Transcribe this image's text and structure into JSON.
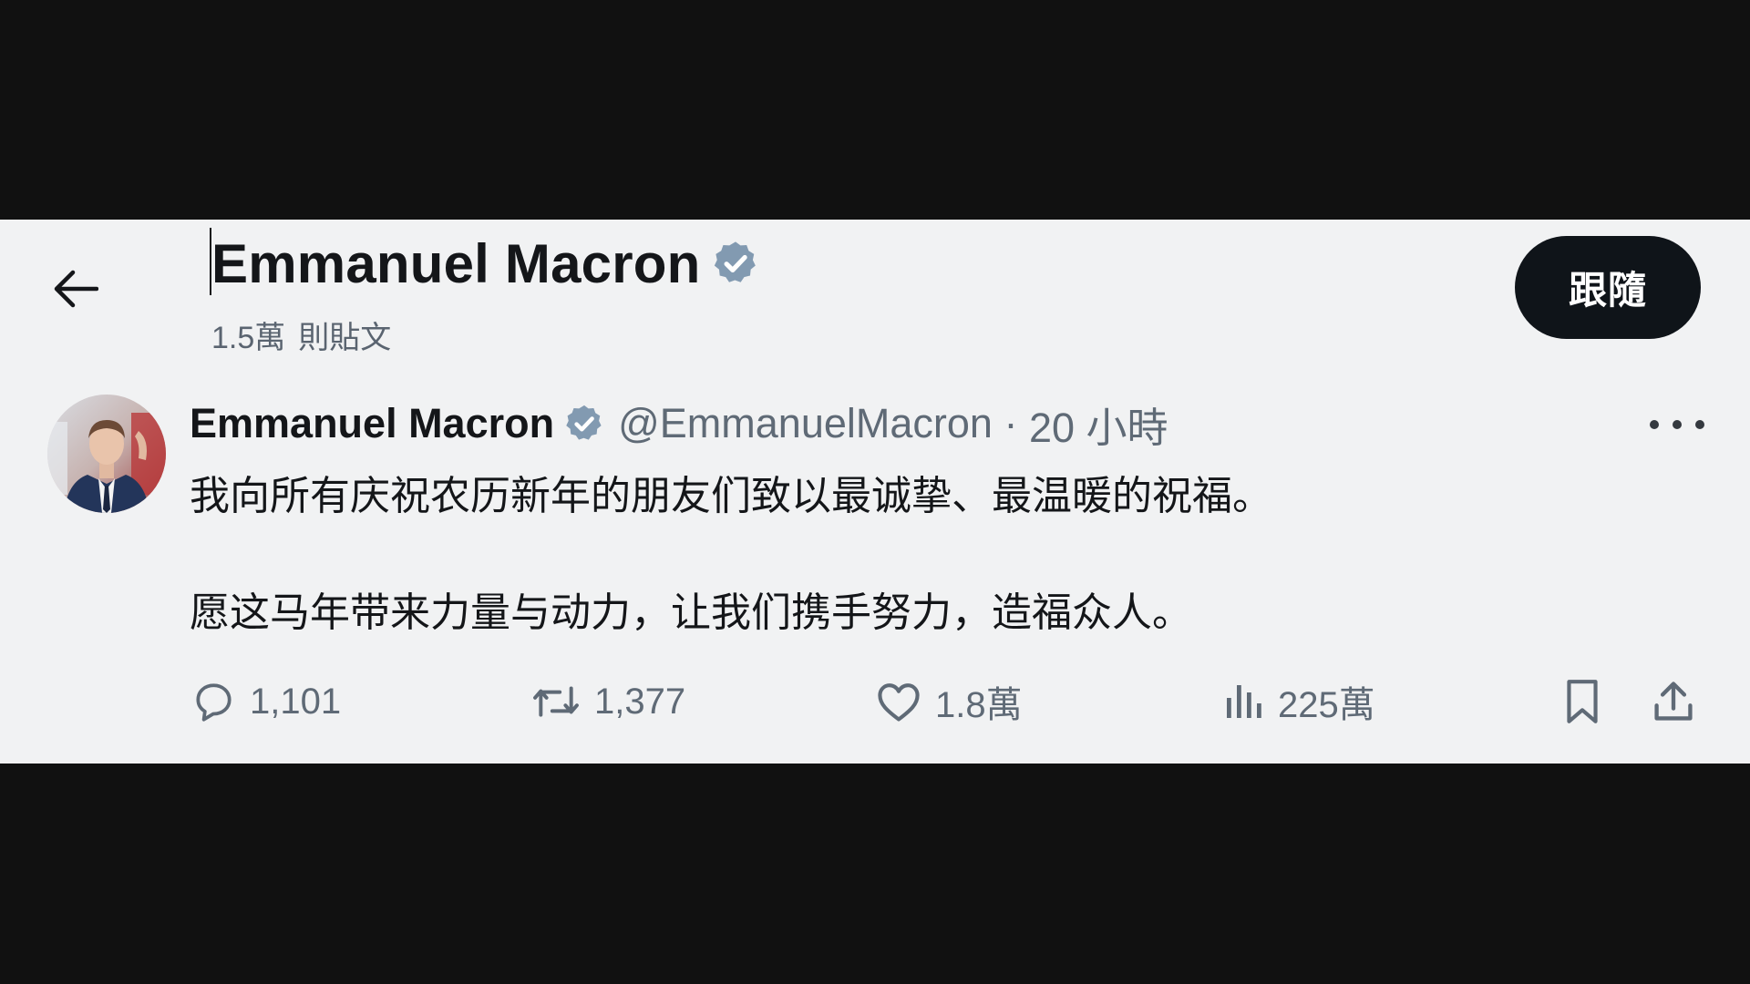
{
  "header": {
    "title": "Emmanuel Macron",
    "post_count": "1.5萬",
    "post_count_label": "則貼文",
    "follow_label": "跟隨"
  },
  "tweet": {
    "author_name": "Emmanuel Macron",
    "handle": "@EmmanuelMacron",
    "separator": "·",
    "time": "20 小時",
    "text_line1": "我向所有庆祝农历新年的朋友们致以最诚挚、最温暖的祝福。",
    "text_line2": "愿这马年带来力量与动力，让我们携手努力，造福众人。"
  },
  "actions": {
    "replies": "1,101",
    "retweets": "1,377",
    "likes": "1.8萬",
    "views": "225萬"
  },
  "icons": {
    "back": "arrow-left-icon",
    "verified": "verified-badge-icon",
    "more": "more-dots-icon",
    "reply": "reply-icon",
    "retweet": "retweet-icon",
    "like": "heart-icon",
    "views": "views-icon",
    "bookmark": "bookmark-icon",
    "share": "share-icon"
  },
  "colors": {
    "panel_background": "#f1f2f3",
    "frame_background": "#111111",
    "verified_badge": "#829ab1",
    "follow_button": "#0f1419",
    "secondary_text": "#5f6a76"
  }
}
